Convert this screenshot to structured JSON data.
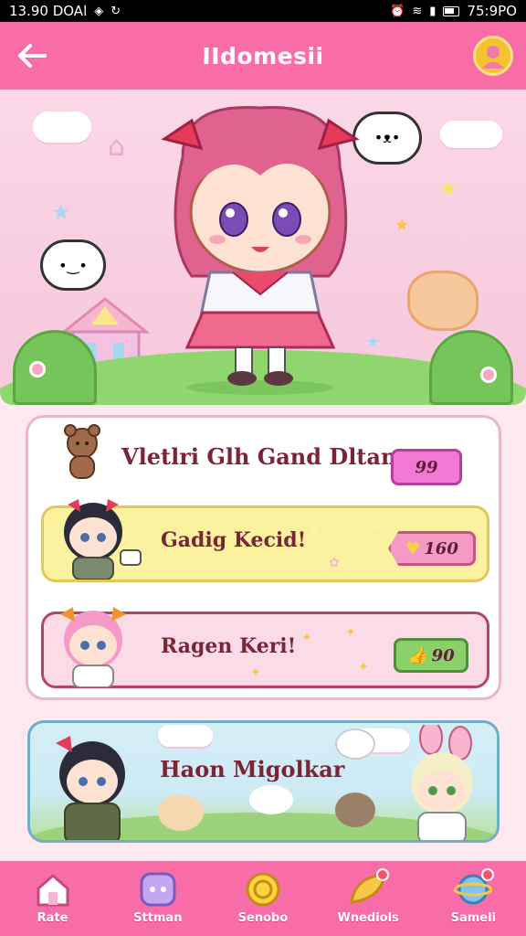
{
  "status_bar": {
    "time_left": "13.90 DOAl",
    "time_right": "75:9PO"
  },
  "app_bar": {
    "title": "IIdomesii"
  },
  "cards": [
    {
      "label": "Vletlri Glh Gand Dltam",
      "badge": "99"
    },
    {
      "label": "Gadig Kecid!",
      "badge": "160"
    },
    {
      "label": "Ragen Keri!",
      "badge": "90"
    }
  ],
  "promo": {
    "label": "Haon Migolkar"
  },
  "tabs": [
    {
      "label": "Rate",
      "icon": "home-icon"
    },
    {
      "label": "Sttman",
      "icon": "chat-icon"
    },
    {
      "label": "Senobo",
      "icon": "coin-icon"
    },
    {
      "label": "Wnediols",
      "icon": "leaf-icon"
    },
    {
      "label": "Sameli",
      "icon": "planet-icon"
    }
  ],
  "colors": {
    "accent": "#f86ca8",
    "row2": "#fbf2a0",
    "row3": "#fbdbe8",
    "badge_green": "#8bd16a"
  }
}
